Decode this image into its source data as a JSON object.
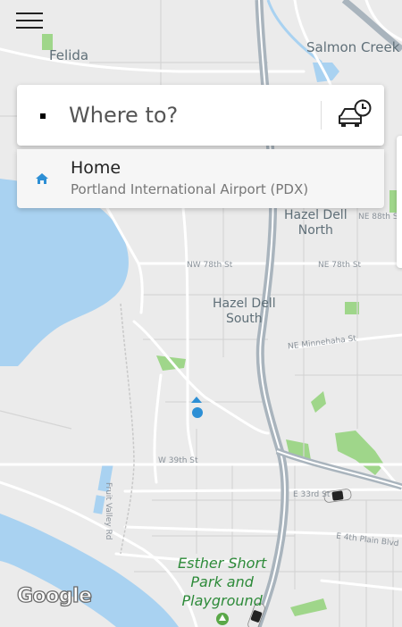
{
  "map": {
    "places": {
      "felida": "Felida",
      "salmon_creek": "Salmon Creek",
      "hazel_dell_north_1": "Hazel Dell",
      "hazel_dell_north_2": "North",
      "hazel_dell_south_1": "Hazel Dell",
      "hazel_dell_south_2": "South"
    },
    "streets": {
      "ne_88th": "NE 88th St",
      "nw_78th": "NW 78th St",
      "ne_78th": "NE 78th St",
      "ne_minnehaha": "NE Minnehaha St",
      "w_39th": "W 39th St",
      "e_33rd": "E 33rd St",
      "fruit_valley": "Fruit Valley Rd",
      "e_4th_plain": "E 4th Plain Blvd"
    },
    "park": {
      "line1": "Esther Short",
      "line2": "Park and",
      "line3": "Playground"
    },
    "attribution": "Google"
  },
  "search": {
    "placeholder": "Where to?",
    "schedule_icon": "car-clock-icon"
  },
  "saved_place": {
    "icon": "home-icon",
    "title": "Home",
    "subtitle": "Portland International Airport (PDX)"
  },
  "menu_icon": "hamburger-menu-icon",
  "colors": {
    "water": "#a9d2f1",
    "park": "#9fd68a",
    "location_dot": "#2d8fd5"
  }
}
